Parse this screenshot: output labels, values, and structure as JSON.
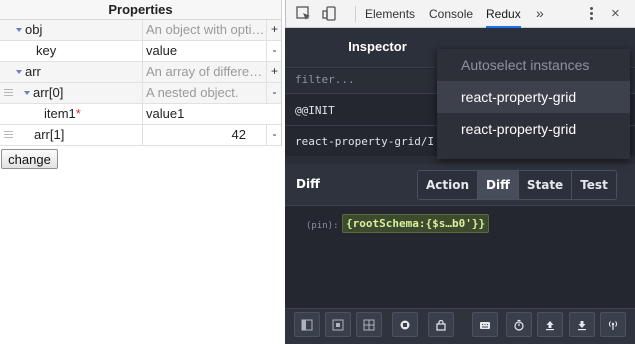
{
  "property_grid": {
    "title": "Properties",
    "rows": [
      {
        "name": "obj",
        "value": "An object with optio...",
        "action": "+"
      },
      {
        "name": "key",
        "value": "value",
        "action": "-"
      },
      {
        "name": "arr",
        "value": "An array of different ...",
        "action": "+"
      },
      {
        "name": "arr[0]",
        "value": "A nested object.",
        "action": "-"
      },
      {
        "name": "item1",
        "required_mark": "*",
        "value": "value1",
        "action": ""
      },
      {
        "name": "arr[1]",
        "value": "42",
        "action": "-"
      }
    ],
    "change_button": "change"
  },
  "devtools": {
    "tabs": {
      "elements": "Elements",
      "console": "Console",
      "redux": "Redux",
      "more": "»"
    },
    "close": "×",
    "inspector_title": "Inspector",
    "filter_placeholder": "filter...",
    "actions": [
      "@@INIT",
      "react-property-grid/I"
    ],
    "diff_label": "Diff",
    "monitor_tabs": {
      "action": "Action",
      "diff": "Diff",
      "state": "State",
      "test": "Test"
    },
    "active_monitor_tab": "Diff",
    "diff_pin": "(pin):",
    "diff_value": "{rootSchema:{$s…b0'}}",
    "footer_icons": [
      "left-dock-icon",
      "bottom-dock-icon",
      "grid-icon",
      "record-icon",
      "lock-icon",
      "keyboard-icon",
      "timer-icon",
      "upload-icon",
      "download-icon",
      "remote-icon"
    ]
  },
  "instance_dropdown": {
    "header": "Autoselect instances",
    "items": [
      "react-property-grid",
      "react-property-grid"
    ],
    "selected_index": 0
  },
  "colors": {
    "devtools_bg": "#242730",
    "accent_blue": "#1a73e8",
    "diff_added": "#d8f0a0"
  }
}
